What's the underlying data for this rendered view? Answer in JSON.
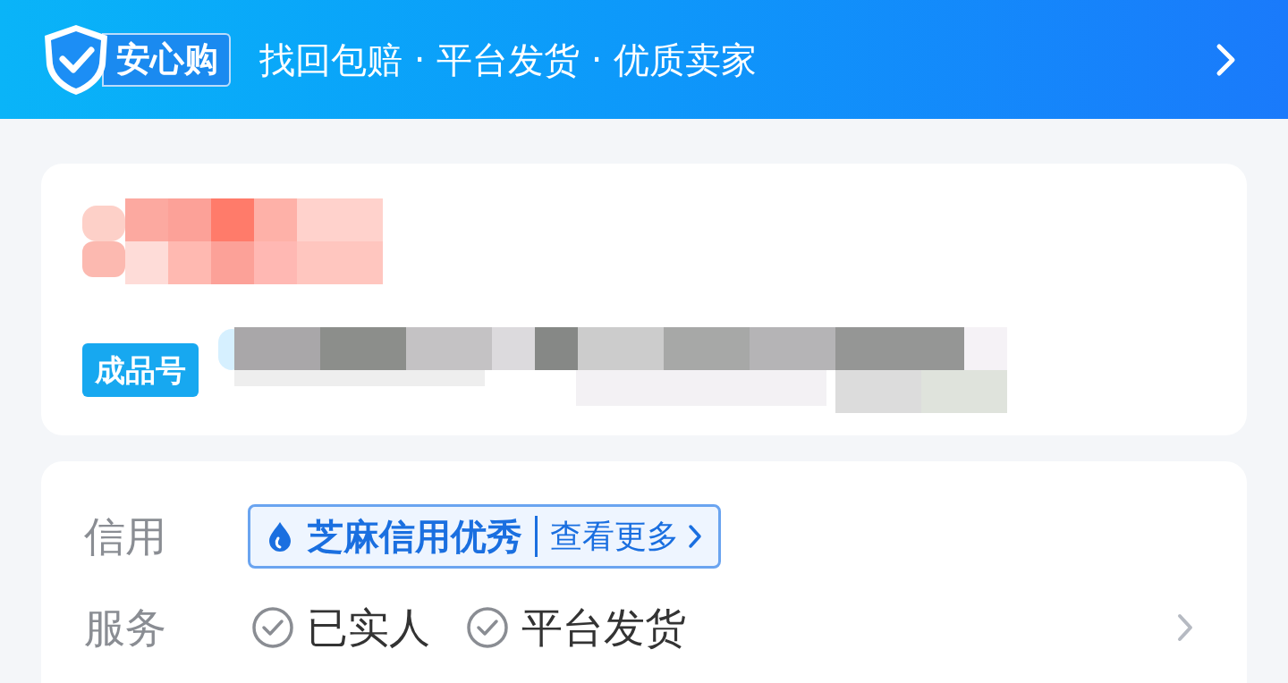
{
  "banner": {
    "badge": "安心购",
    "slogan": "找回包赔 · 平台发货 · 优质卖家"
  },
  "product": {
    "tag": "成品号"
  },
  "info_rows": [
    {
      "kind": "credit",
      "label": "信用",
      "title": "芝麻信用优秀",
      "link": "查看更多"
    },
    {
      "kind": "services",
      "label": "服务",
      "items": [
        "已实人",
        "平台发货"
      ]
    }
  ]
}
